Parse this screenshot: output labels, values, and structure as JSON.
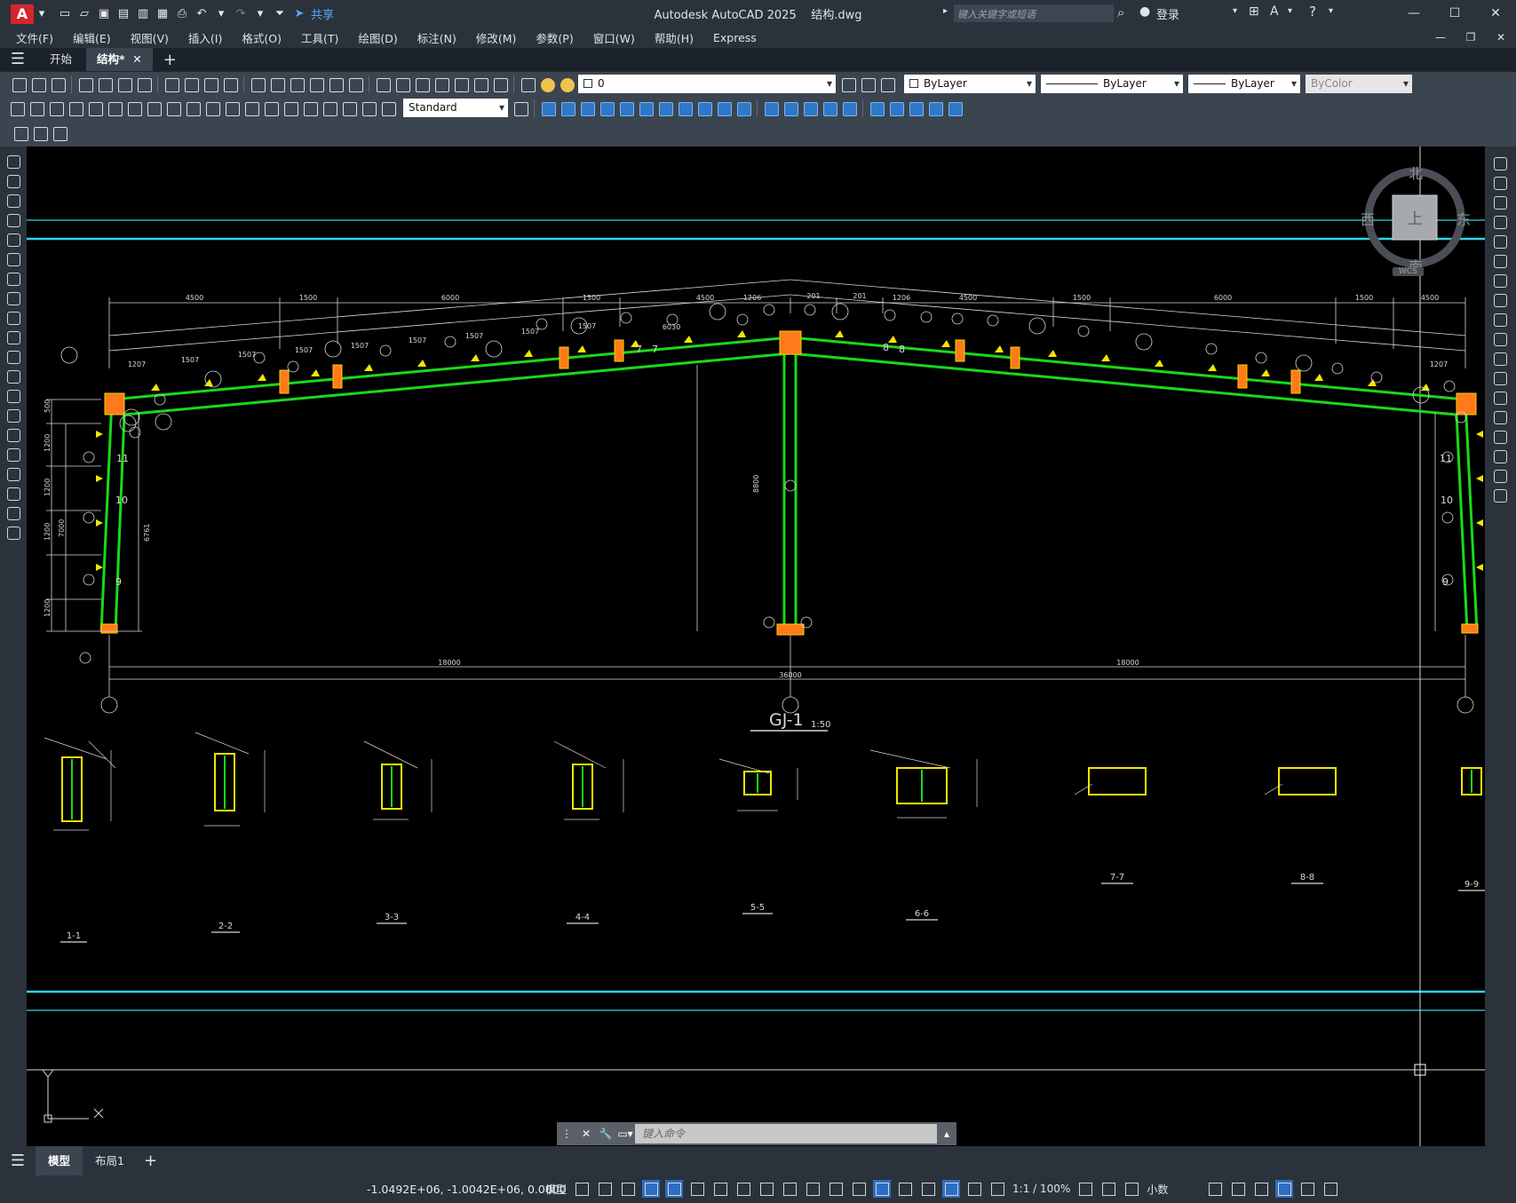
{
  "titlebar": {
    "app_title": "Autodesk AutoCAD 2025",
    "file_name": "结构.dwg",
    "share_label": "共享",
    "search_placeholder": "键入关键字或短语",
    "login_label": "登录",
    "logo_letter": "A"
  },
  "menu": [
    "文件(F)",
    "编辑(E)",
    "视图(V)",
    "插入(I)",
    "格式(O)",
    "工具(T)",
    "绘图(D)",
    "标注(N)",
    "修改(M)",
    "参数(P)",
    "窗口(W)",
    "帮助(H)",
    "Express"
  ],
  "file_tabs": [
    "开始",
    "结构*"
  ],
  "properties": {
    "layer_value": "0",
    "color_value": "ByLayer",
    "linetype_value": "ByLayer",
    "lineweight_value": "ByLayer",
    "plotstyle_value": "ByColor",
    "dimstyle_value": "Standard"
  },
  "viewcube": {
    "north": "北",
    "south": "南",
    "east": "东",
    "west": "西",
    "top": "上",
    "wcs": "WCS"
  },
  "drawing": {
    "title": "GJ-1",
    "scale": "1:50",
    "overall_span": "36000",
    "half_span_left": "18000",
    "half_span_right": "18000",
    "top_dims": [
      "4500",
      "1500",
      "6000",
      "1500",
      "4500",
      "1206",
      "201",
      "201",
      "1206",
      "4500",
      "1500",
      "6000",
      "1500",
      "4500"
    ],
    "slope_dims": [
      "1207",
      "1507",
      "1507",
      "1507",
      "1507",
      "1507",
      "1507",
      "1507",
      "1507",
      "6030",
      "1207"
    ],
    "left_height_dims": [
      "1200",
      "1200",
      "1200",
      "1200",
      "7000",
      "500"
    ],
    "col_height": "6761",
    "mid_height": "8800",
    "sections": [
      "1-1",
      "2-2",
      "3-3",
      "4-4",
      "5-5",
      "6-6",
      "7-7",
      "8-8",
      "9-9"
    ]
  },
  "command": {
    "placeholder": "键入命令"
  },
  "layout_tabs": [
    "模型",
    "布局1"
  ],
  "status": {
    "coordinates": "-1.0492E+06, -1.0042E+06, 0.0000",
    "model_label": "模型",
    "scale_label": "1:1 / 100%",
    "units_label": "小数"
  },
  "colors": {
    "canvas_bg": "#000000",
    "frame_green": "#19d919",
    "cyan_line": "#2ad7e6",
    "dim_white": "#d8d8d8",
    "section_yellow": "#f2e600",
    "node_orange": "#ff7a1a"
  }
}
